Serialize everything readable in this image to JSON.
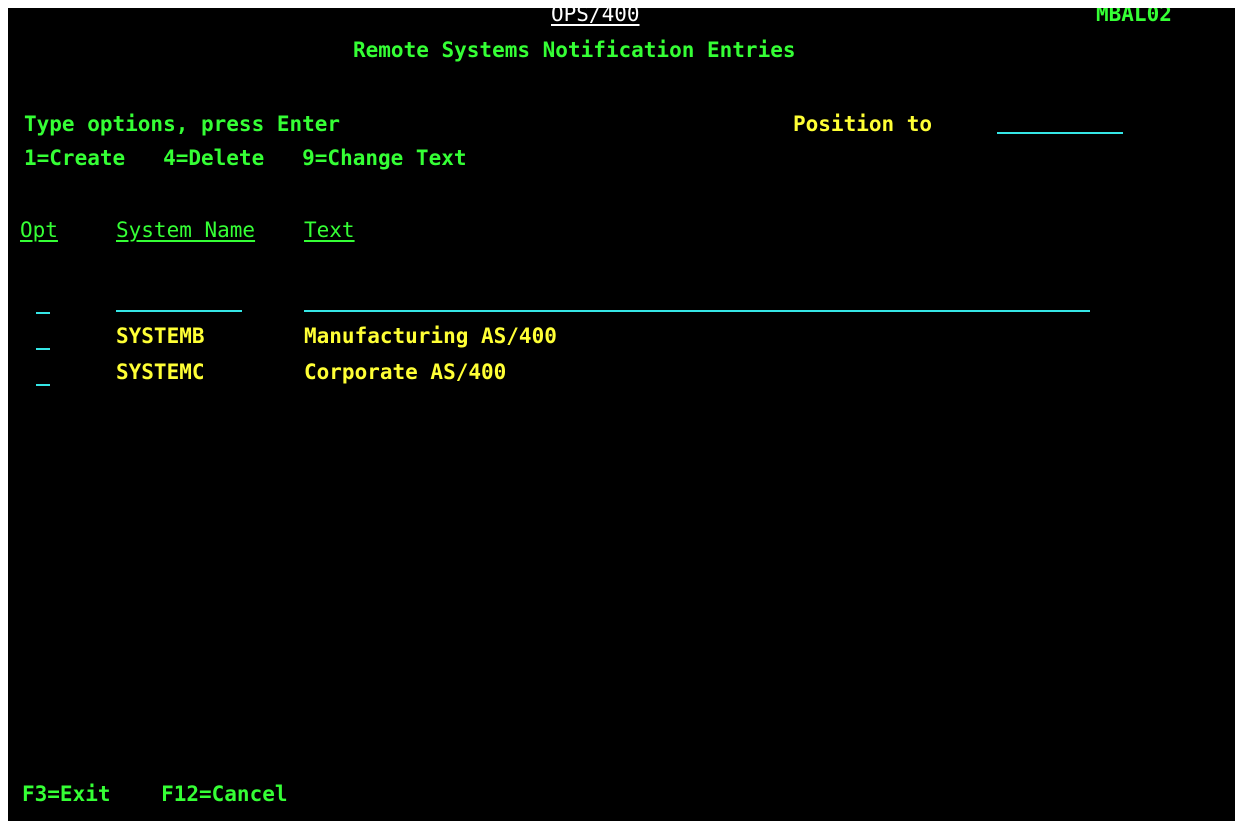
{
  "header": {
    "product": "OPS/400",
    "screen_id": "MBAL02",
    "title": "Remote Systems Notification Entries"
  },
  "instructions": {
    "prompt": "Type options, press Enter",
    "options": "1=Create   4=Delete   9=Change Text"
  },
  "position_to": {
    "label": "Position to",
    "value": ""
  },
  "columns": {
    "opt": "Opt",
    "system_name": "System Name",
    "text": "Text"
  },
  "new_entry": {
    "opt": "",
    "system_name": "",
    "text": ""
  },
  "rows": [
    {
      "opt": "",
      "system_name": "SYSTEMB",
      "text": "Manufacturing AS/400"
    },
    {
      "opt": "",
      "system_name": "SYSTEMC",
      "text": "Corporate AS/400"
    }
  ],
  "function_keys": "F3=Exit    F12=Cancel",
  "colors": {
    "background": "#000000",
    "green": "#35ff35",
    "yellow": "#ffff35",
    "input_underline": "#35e6e6"
  }
}
